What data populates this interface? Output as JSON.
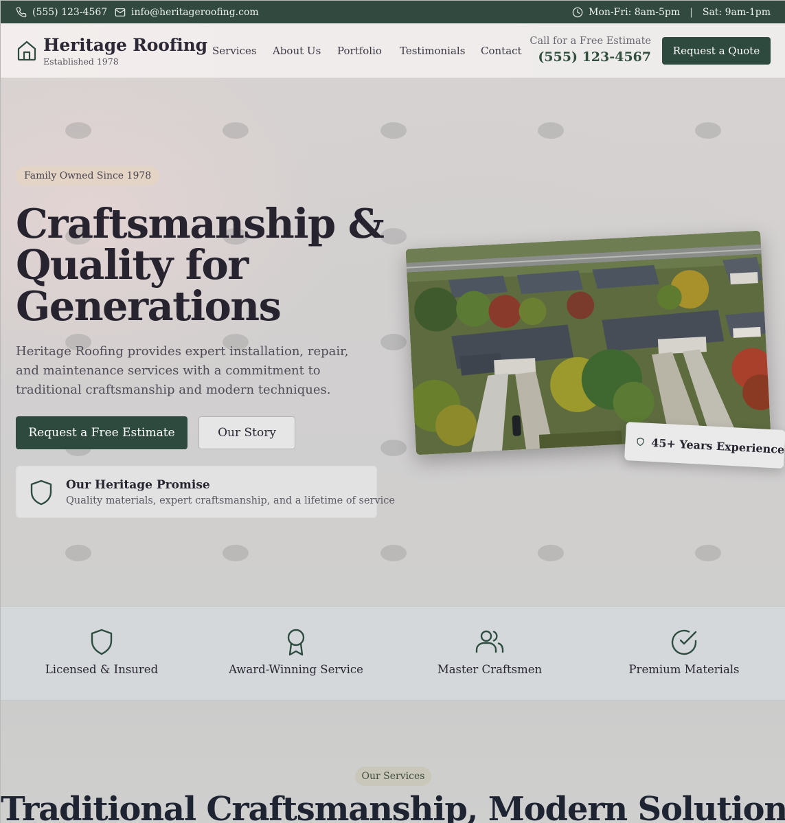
{
  "topbar": {
    "phone": "(555) 123-4567",
    "email": "info@heritageroofing.com",
    "hours_weekday": "Mon-Fri: 8am-5pm",
    "hours_sep": "|",
    "hours_weekend": "Sat: 9am-1pm",
    "background": "#32493f"
  },
  "header": {
    "brand": "Heritage Roofing",
    "established": "Established 1978",
    "nav": [
      "Services",
      "About Us",
      "Portfolio",
      "Testimonials",
      "Contact"
    ],
    "cta_label": "Call for a Free Estimate",
    "cta_phone": "(555) 123-4567",
    "quote_button": "Request a Quote",
    "accent": "#2e4a3e"
  },
  "hero": {
    "badge": "Family Owned Since 1978",
    "headline": [
      "Craftsmanship &",
      "Quality for",
      "Generations"
    ],
    "lead": "Heritage Roofing provides expert installation, repair, and maintenance services with a commitment to traditional craftsmanship and modern techniques.",
    "primary_button": "Request a Free Estimate",
    "secondary_button": "Our Story",
    "promise_title": "Our Heritage Promise",
    "promise_text": "Quality materials, expert craftsmanship, and a lifetime of service",
    "experience_badge": "45+ Years Experience",
    "image_icon": "aerial-neighborhood-photo"
  },
  "features": [
    {
      "label": "Licensed & Insured",
      "icon": "shield-icon"
    },
    {
      "label": "Award-Winning Service",
      "icon": "award-icon"
    },
    {
      "label": "Master Craftsmen",
      "icon": "users-icon"
    },
    {
      "label": "Premium Materials",
      "icon": "check-circle-icon"
    }
  ],
  "services": {
    "badge": "Our Services",
    "title": "Traditional Craftsmanship, Modern Solutions"
  }
}
